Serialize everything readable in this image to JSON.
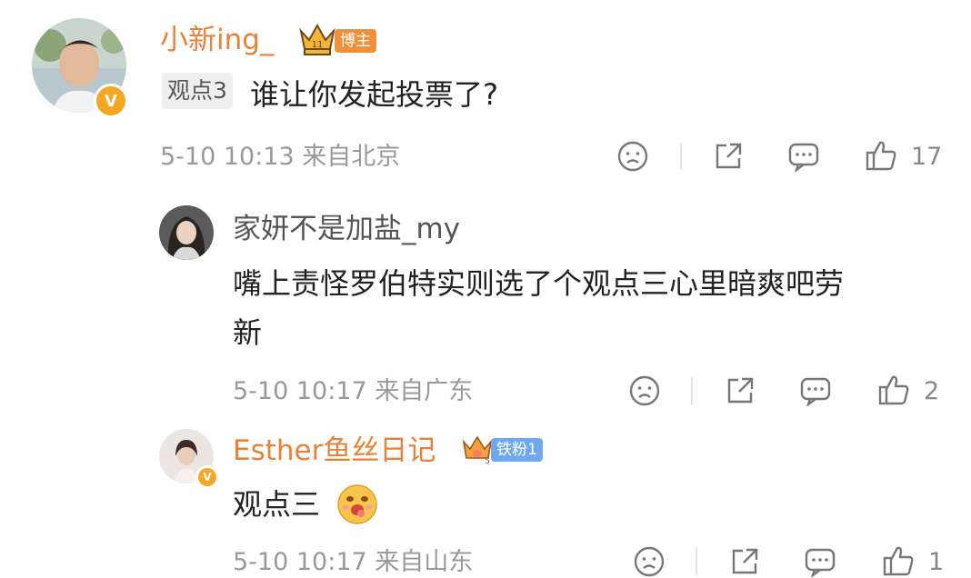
{
  "comments": [
    {
      "username": "小新ing_",
      "badge": "博主",
      "crown_level": "11",
      "tag": "观点3",
      "content": "谁让你发起投票了?",
      "time_location": "5-10 10:13 来自北京",
      "likes": "17",
      "verified_mark": "V"
    },
    {
      "username": "家妍不是加盐_my",
      "content_lines": [
        "嘴上责怪罗伯特实则选了个观点三心里暗爽吧劳",
        "新"
      ],
      "time_location": "5-10 10:17 来自广东",
      "likes": "2"
    },
    {
      "username": "Esther鱼丝日记",
      "badge": "铁粉1",
      "crown_level": "5",
      "content": "观点三",
      "time_location": "5-10 10:17 来自山东",
      "likes": "1"
    }
  ],
  "icons": [
    "sad-face-icon",
    "share-icon",
    "comment-icon",
    "thumbs-up-icon"
  ],
  "colors": {
    "username_accent": "#e8823a",
    "badge_orange": "#f0913a",
    "badge_blue": "#6fa8ec",
    "meta_gray": "#999999"
  }
}
